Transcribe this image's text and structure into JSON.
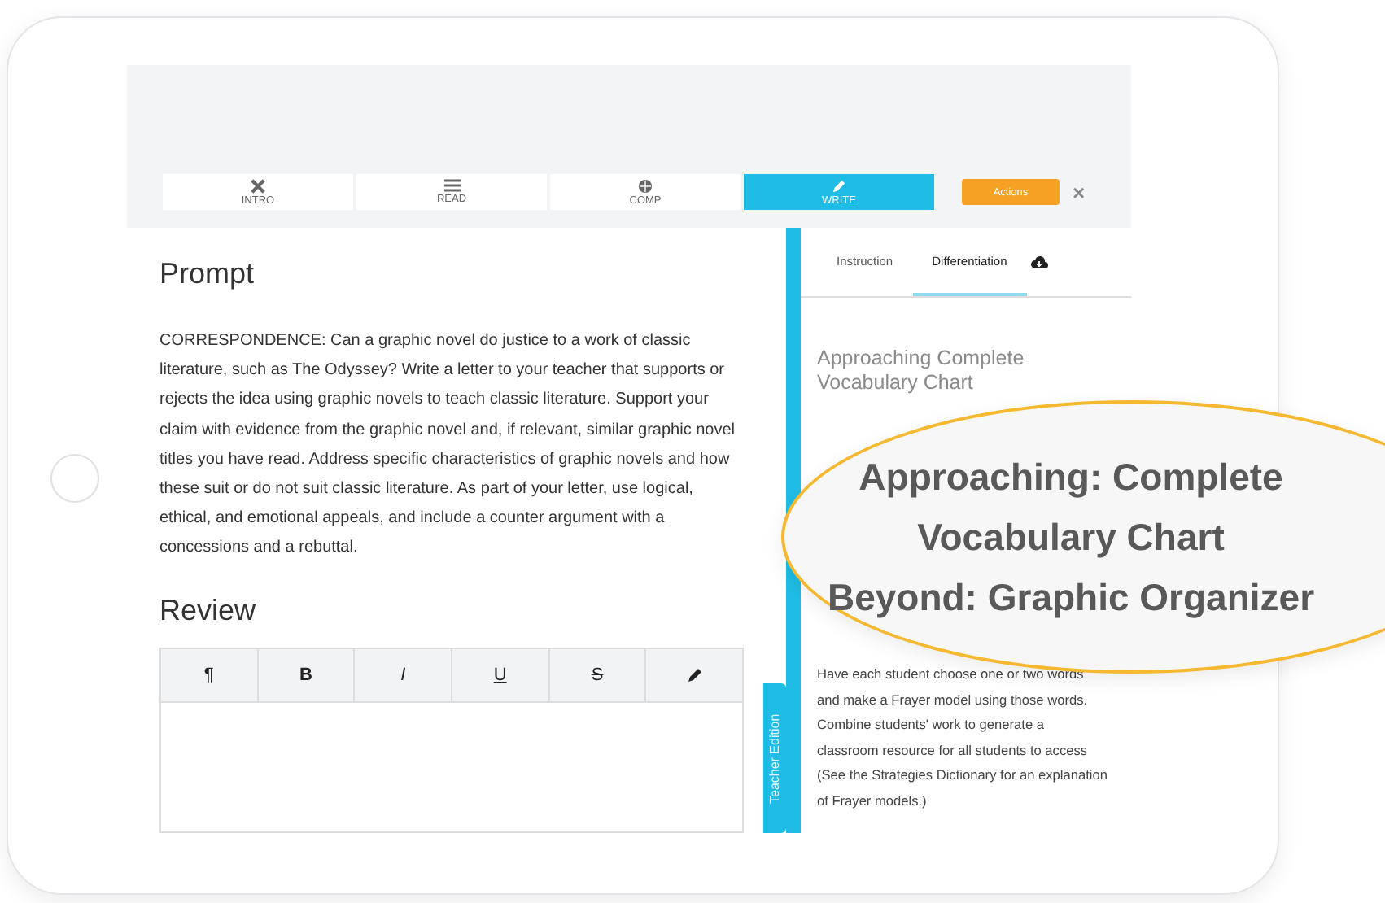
{
  "nav_tabs": [
    {
      "label": "INTRO",
      "selected": false
    },
    {
      "label": "READ",
      "selected": false
    },
    {
      "label": "COMP",
      "selected": false
    },
    {
      "label": "WRITE",
      "selected": true
    }
  ],
  "actions_button": "Actions",
  "close": "×",
  "prompt": {
    "title": "Prompt",
    "text": "CORRESPONDENCE: Can a graphic novel do justice to a work of classic literature, such as The Odyssey? Write a letter to your teacher that supports or rejects the idea using graphic novels to teach classic literature. Support your claim with evidence from the graphic novel and, if relevant, similar graphic novel titles you have read. Address specific characteristics of graphic novels and how these suit or do not suit classic literature. As part of your letter, use logical, ethical, and emotional appeals, and include a counter argument with a concessions and a rebuttal."
  },
  "review": {
    "title": "Review",
    "toolbar": [
      {
        "kind": "text",
        "label": "¶"
      },
      {
        "kind": "bold",
        "label": "B"
      },
      {
        "kind": "italic",
        "label": "I"
      },
      {
        "kind": "underline",
        "label": "U"
      },
      {
        "kind": "strike",
        "label": "S"
      },
      {
        "kind": "pencil"
      }
    ]
  },
  "side_panel": {
    "tabs": [
      {
        "label": "Instruction",
        "selected": false
      },
      {
        "label": "Differentiation",
        "selected": true
      }
    ],
    "edition_tab": "Teacher Edition",
    "heading": "Approaching Complete Vocabulary Chart",
    "text": "Have each student choose one or two words and make a Frayer model using those words. Combine students' work to generate a classroom resource for all students to access (See the Strategies Dictionary for an explanation of Frayer models.)"
  },
  "magnifier": {
    "lines": [
      "Approaching: Complete",
      "Vocabulary Chart",
      "Beyond: Graphic Organizer"
    ]
  }
}
